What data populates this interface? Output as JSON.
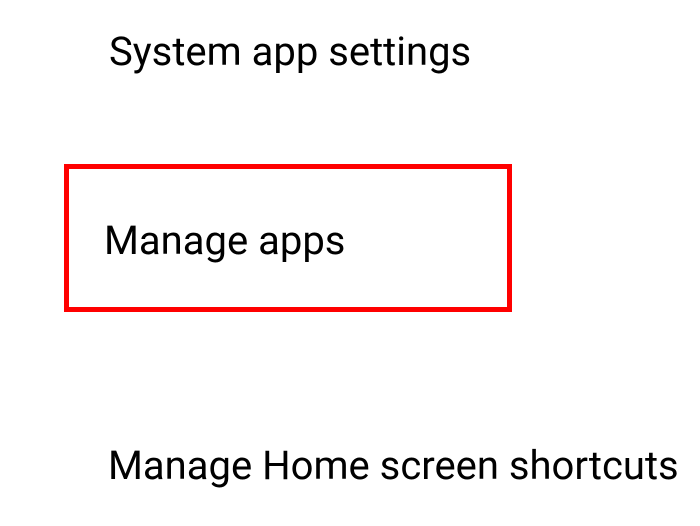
{
  "settings": {
    "items": [
      {
        "label": "System app settings"
      },
      {
        "label": "Manage apps"
      },
      {
        "label": "Manage Home screen shortcuts"
      }
    ]
  },
  "highlight": {
    "color": "#ff0000"
  }
}
